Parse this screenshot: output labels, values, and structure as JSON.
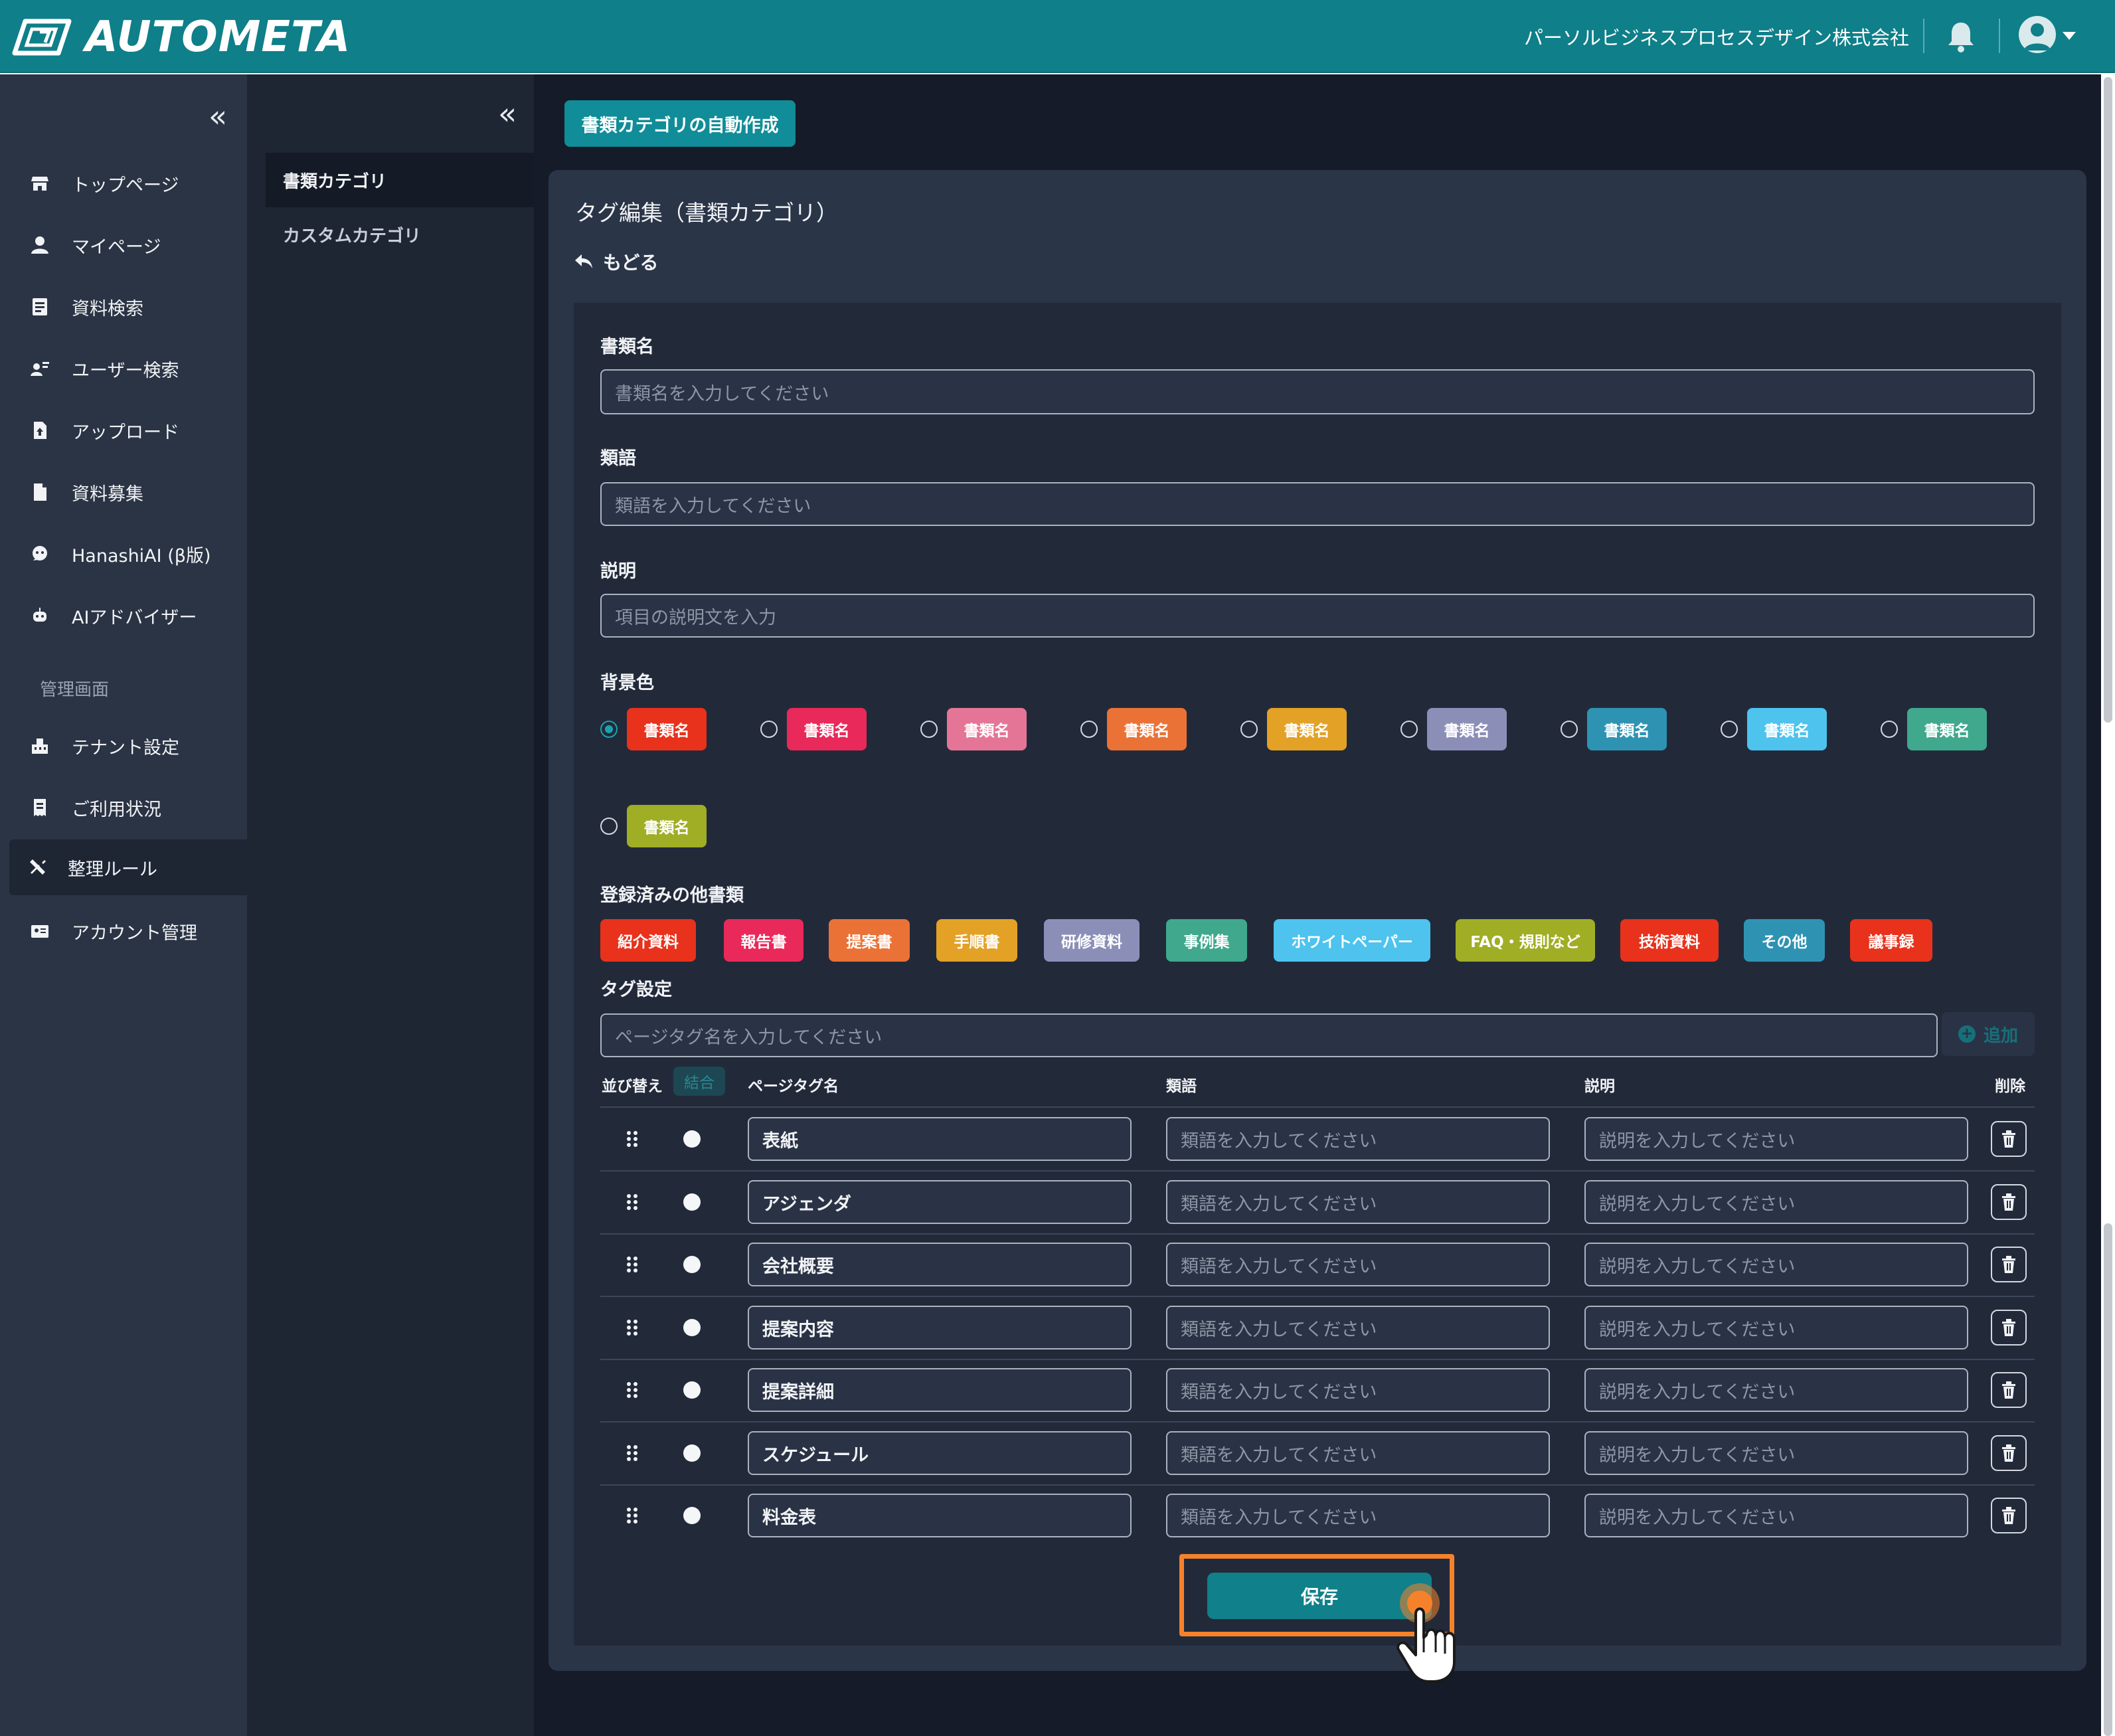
{
  "header": {
    "brand": "AUTOMETA",
    "company": "パーソルビジネスプロセスデザイン株式会社",
    "color": "#0f7f89"
  },
  "sidebar": {
    "collapse_glyph": "«",
    "items": [
      {
        "label": "トップページ",
        "icon": "store-icon"
      },
      {
        "label": "マイページ",
        "icon": "user-icon"
      },
      {
        "label": "資料検索",
        "icon": "document-search-icon"
      },
      {
        "label": "ユーザー検索",
        "icon": "user-search-icon"
      },
      {
        "label": "アップロード",
        "icon": "upload-file-icon"
      },
      {
        "label": "資料募集",
        "icon": "file-icon"
      },
      {
        "label": "HanashiAI (β版)",
        "icon": "chat-bot-icon"
      },
      {
        "label": "AIアドバイザー",
        "icon": "robot-icon"
      }
    ],
    "section_label": "管理画面",
    "admin_items": [
      {
        "label": "テナント設定",
        "icon": "building-icon"
      },
      {
        "label": "ご利用状況",
        "icon": "receipt-icon"
      },
      {
        "label": "整理ルール",
        "icon": "tools-icon",
        "active": true
      },
      {
        "label": "アカウント管理",
        "icon": "id-card-icon"
      }
    ]
  },
  "subnav": {
    "collapse_glyph": "«",
    "items": [
      {
        "label": "書類カテゴリ",
        "active": true
      },
      {
        "label": "カスタムカテゴリ",
        "active": false
      }
    ]
  },
  "main": {
    "auto_create_button": "書類カテゴリの自動作成",
    "card_title": "タグ編集（書類カテゴリ）",
    "back_label": "もどる",
    "doc_name": {
      "label": "書類名",
      "placeholder": "書類名を入力してください"
    },
    "synonym": {
      "label": "類語",
      "placeholder": "類語を入力してください"
    },
    "description": {
      "label": "説明",
      "placeholder": "項目の説明文を入力"
    },
    "bg_color": {
      "label": "背景色",
      "sample_text": "書類名",
      "options": [
        {
          "color": "#e8321c",
          "selected": true
        },
        {
          "color": "#e9295a",
          "selected": false
        },
        {
          "color": "#e57596",
          "selected": false
        },
        {
          "color": "#ea7236",
          "selected": false
        },
        {
          "color": "#e3a126",
          "selected": false
        },
        {
          "color": "#8b8fb8",
          "selected": false
        },
        {
          "color": "#2e93b3",
          "selected": false
        },
        {
          "color": "#4dc3ee",
          "selected": false
        },
        {
          "color": "#3fa88d",
          "selected": false
        },
        {
          "color": "#a0ae25",
          "selected": false
        }
      ]
    },
    "registered": {
      "label": "登録済みの他書類",
      "tags": [
        {
          "label": "紹介資料",
          "color": "#e8321c"
        },
        {
          "label": "報告書",
          "color": "#e9295a"
        },
        {
          "label": "提案書",
          "color": "#ea7236"
        },
        {
          "label": "手順書",
          "color": "#e3a126"
        },
        {
          "label": "研修資料",
          "color": "#8b8fb8"
        },
        {
          "label": "事例集",
          "color": "#3fa88d"
        },
        {
          "label": "ホワイトペーパー",
          "color": "#4dc3ee"
        },
        {
          "label": "FAQ・規則など",
          "color": "#a0ae25"
        },
        {
          "label": "技術資料",
          "color": "#e8321c"
        },
        {
          "label": "その他",
          "color": "#2e93b3"
        },
        {
          "label": "議事録",
          "color": "#e8321c"
        }
      ]
    },
    "tag_settings": {
      "label": "タグ設定",
      "placeholder": "ページタグ名を入力してください",
      "add_label": "追加",
      "columns": {
        "sort": "並び替え",
        "merge": "結合",
        "name": "ページタグ名",
        "synonym": "類語",
        "description": "説明",
        "delete": "削除"
      },
      "synonym_placeholder": "類語を入力してください",
      "description_placeholder": "説明を入力してください",
      "rows": [
        {
          "name": "表紙"
        },
        {
          "name": "アジェンダ"
        },
        {
          "name": "会社概要"
        },
        {
          "name": "提案内容"
        },
        {
          "name": "提案詳細"
        },
        {
          "name": "スケジュール"
        },
        {
          "name": "料金表"
        }
      ]
    },
    "save_label": "保存"
  }
}
